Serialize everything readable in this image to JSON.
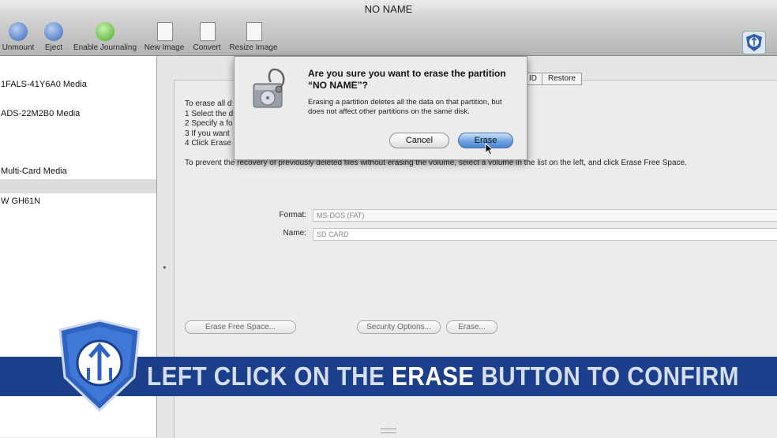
{
  "window": {
    "title": "NO NAME"
  },
  "toolbar": {
    "items": [
      {
        "label": "Unmount",
        "icon": "unmount-icon"
      },
      {
        "label": "Eject",
        "icon": "eject-icon"
      },
      {
        "label": "Enable Journaling",
        "icon": "journaling-icon"
      },
      {
        "label": "New Image",
        "icon": "new-image-icon"
      },
      {
        "label": "Convert",
        "icon": "convert-icon"
      },
      {
        "label": "Resize Image",
        "icon": "resize-image-icon"
      }
    ]
  },
  "sidebar": {
    "items": [
      {
        "label": "1FALS-41Y6A0 Media"
      },
      {
        "label": "ADS-22M2B0 Media"
      },
      {
        "label": "Multi-Card Media"
      },
      {
        "label": ""
      },
      {
        "label": "W GH61N"
      }
    ]
  },
  "tabs": {
    "raid": "ID",
    "restore": "Restore"
  },
  "instructions": {
    "line0": "To erase all d",
    "line1": "1  Select the d",
    "line2": "2  Specify a fo",
    "line3": "3  If you want",
    "line4": "4  Click Erase",
    "prevent": "To prevent the recovery of previously deleted files without erasing the volume, select a volume in the list on the left, and click Erase Free Space."
  },
  "form": {
    "format_label": "Format:",
    "format_value": "MS-DOS (FAT)",
    "name_label": "Name:",
    "name_value": "SD CARD"
  },
  "buttons": {
    "erase_free_space": "Erase Free Space...",
    "security_options": "Security Options...",
    "erase": "Erase..."
  },
  "dialog": {
    "title": "Are you sure you want to erase the partition “NO NAME”?",
    "message": "Erasing a partition deletes all the data on that partition, but does not affect other partitions on the same disk.",
    "cancel_label": "Cancel",
    "erase_label": "Erase"
  },
  "banner": {
    "text_before": "LEFT CLICK ON THE ",
    "text_bold": "ERASE",
    "text_after": " BUTTON TO CONFIRM"
  },
  "colors": {
    "banner": "#1c3f8c",
    "erase_button": "#6fa3e0"
  }
}
